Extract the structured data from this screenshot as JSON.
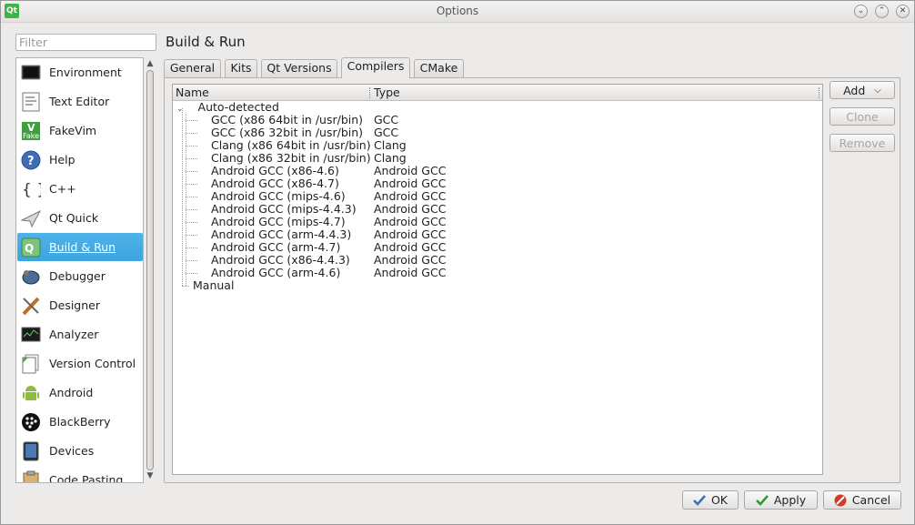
{
  "window": {
    "title": "Options",
    "app_icon_text": "Qt"
  },
  "filter": {
    "placeholder": "Filter",
    "value": ""
  },
  "page_title": "Build & Run",
  "sidebar": {
    "items": [
      {
        "label": "Environment",
        "icon": "environment-icon"
      },
      {
        "label": "Text Editor",
        "icon": "text-editor-icon"
      },
      {
        "label": "FakeVim",
        "icon": "fakevim-icon"
      },
      {
        "label": "Help",
        "icon": "help-icon"
      },
      {
        "label": "C++",
        "icon": "cpp-icon"
      },
      {
        "label": "Qt Quick",
        "icon": "qt-quick-icon"
      },
      {
        "label": "Build & Run",
        "icon": "build-run-icon",
        "selected": true
      },
      {
        "label": "Debugger",
        "icon": "debugger-icon"
      },
      {
        "label": "Designer",
        "icon": "designer-icon"
      },
      {
        "label": "Analyzer",
        "icon": "analyzer-icon"
      },
      {
        "label": "Version Control",
        "icon": "version-control-icon"
      },
      {
        "label": "Android",
        "icon": "android-icon"
      },
      {
        "label": "BlackBerry",
        "icon": "blackberry-icon"
      },
      {
        "label": "Devices",
        "icon": "devices-icon"
      },
      {
        "label": "Code Pasting",
        "icon": "code-pasting-icon"
      }
    ]
  },
  "tabs": [
    {
      "label": "General"
    },
    {
      "label": "Kits"
    },
    {
      "label": "Qt Versions"
    },
    {
      "label": "Compilers",
      "active": true
    },
    {
      "label": "CMake"
    }
  ],
  "tree": {
    "columns": [
      "Name",
      "Type"
    ],
    "groups": [
      {
        "label": "Auto-detected",
        "expanded": true,
        "rows": [
          {
            "name": "GCC (x86 64bit in /usr/bin)",
            "type": "GCC"
          },
          {
            "name": "GCC (x86 32bit in /usr/bin)",
            "type": "GCC"
          },
          {
            "name": "Clang (x86 64bit in /usr/bin)",
            "type": "Clang"
          },
          {
            "name": "Clang (x86 32bit in /usr/bin)",
            "type": "Clang"
          },
          {
            "name": "Android GCC (x86-4.6)",
            "type": "Android GCC"
          },
          {
            "name": "Android GCC (x86-4.7)",
            "type": "Android GCC"
          },
          {
            "name": "Android GCC (mips-4.6)",
            "type": "Android GCC"
          },
          {
            "name": "Android GCC (mips-4.4.3)",
            "type": "Android GCC"
          },
          {
            "name": "Android GCC (mips-4.7)",
            "type": "Android GCC"
          },
          {
            "name": "Android GCC (arm-4.4.3)",
            "type": "Android GCC"
          },
          {
            "name": "Android GCC (arm-4.7)",
            "type": "Android GCC"
          },
          {
            "name": "Android GCC (x86-4.4.3)",
            "type": "Android GCC"
          },
          {
            "name": "Android GCC (arm-4.6)",
            "type": "Android GCC"
          }
        ]
      },
      {
        "label": "Manual",
        "expanded": false,
        "rows": []
      }
    ]
  },
  "side_buttons": {
    "add": "Add",
    "clone": "Clone",
    "remove": "Remove"
  },
  "footer": {
    "ok": "OK",
    "apply": "Apply",
    "cancel": "Cancel"
  },
  "colors": {
    "accent": "#3ea4dd",
    "ok_check": "#3b6fb6",
    "apply_check": "#2e9a2e",
    "cancel_red": "#d43a2a"
  }
}
